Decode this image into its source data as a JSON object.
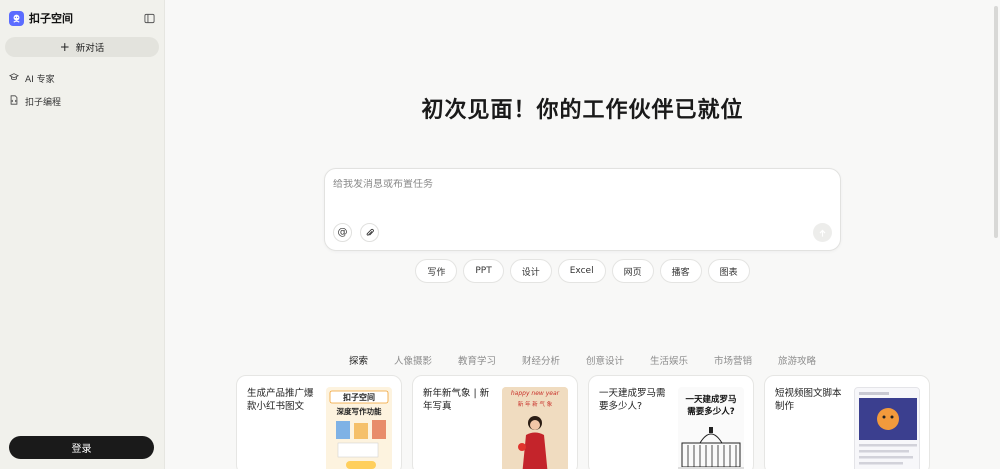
{
  "app": {
    "name": "扣子空间",
    "brand_color": "#5b6cff"
  },
  "sidebar": {
    "new_chat_label": "新对话",
    "items": [
      {
        "label": "AI 专家",
        "icon": "graduation-cap-icon"
      },
      {
        "label": "扣子编程",
        "icon": "code-file-icon"
      }
    ],
    "login_label": "登录"
  },
  "main": {
    "title": "初次见面！你的工作伙伴已就位",
    "composer": {
      "placeholder": "给我发消息或布置任务",
      "value": ""
    },
    "quick_chips": [
      "写作",
      "PPT",
      "设计",
      "Excel",
      "网页",
      "播客",
      "图表"
    ],
    "tabs": [
      "探索",
      "人像摄影",
      "教育学习",
      "财经分析",
      "创意设计",
      "生活娱乐",
      "市场营销",
      "旅游攻略"
    ],
    "active_tab": "探索",
    "cards": [
      {
        "title": "生成产品推广爆款小红书图文",
        "thumb_text_1": "扣子空间",
        "thumb_text_2": "深度写作功能"
      },
      {
        "title": "新年新气象 | 新年写真",
        "thumb_text_1": "happy new year",
        "thumb_text_2": "新 年 新 气 象"
      },
      {
        "title": "一天建成罗马需要多少人?",
        "thumb_text_1": "一天建成罗马",
        "thumb_text_2": "需要多少人?"
      },
      {
        "title": "短视频图文脚本制作",
        "thumb_text_1": "",
        "thumb_text_2": ""
      }
    ]
  }
}
